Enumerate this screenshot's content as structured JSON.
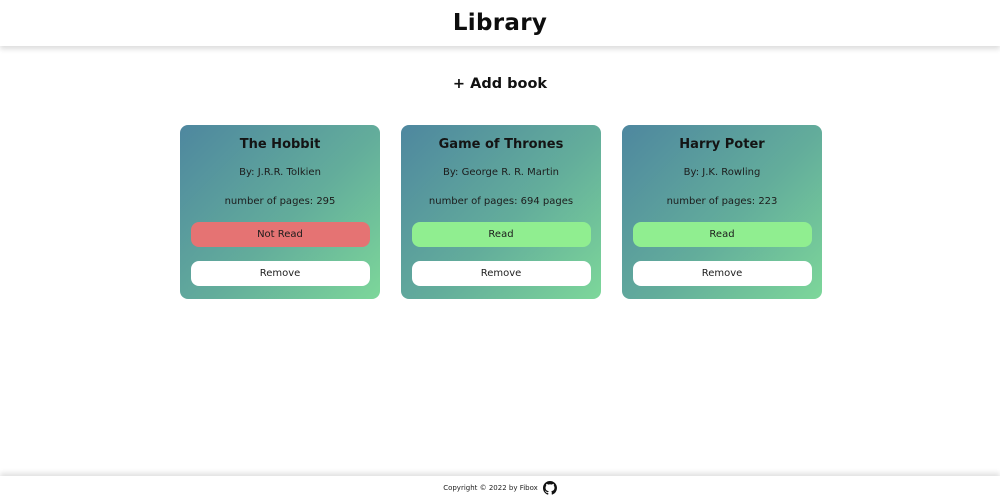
{
  "header": {
    "title": "Library"
  },
  "actions": {
    "add_book_label": "+ Add book"
  },
  "books": [
    {
      "title": "The Hobbit",
      "author": "By: J.R.R. Tolkien",
      "pages": "number of pages: 295",
      "status": "Not Read",
      "remove": "Remove"
    },
    {
      "title": "Game of Thrones",
      "author": "By: George R. R. Martin",
      "pages": "number of pages: 694 pages",
      "status": "Read",
      "remove": "Remove"
    },
    {
      "title": "Harry Poter",
      "author": "By: J.K. Rowling",
      "pages": "number of pages: 223",
      "status": "Read",
      "remove": "Remove"
    }
  ],
  "footer": {
    "copyright": "Copyright © 2022 by Fibox",
    "icon": "github-icon"
  },
  "colors": {
    "card_gradient_start": "#4e879f",
    "card_gradient_end": "#7dd79a",
    "read": "#90ee90",
    "not_read": "#e57373"
  }
}
